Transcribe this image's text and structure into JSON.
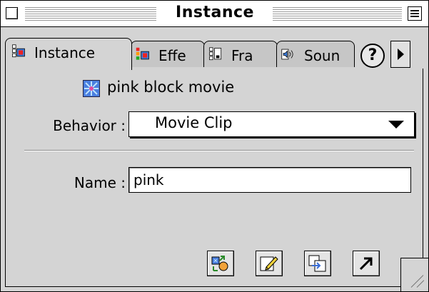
{
  "window": {
    "title": "Instance"
  },
  "tabs": [
    {
      "label": "Instance",
      "icon": "instance-icon",
      "active": true
    },
    {
      "label": "Effe",
      "icon": "effect-icon",
      "active": false
    },
    {
      "label": "Fra",
      "icon": "frame-icon",
      "active": false
    },
    {
      "label": "Soun",
      "icon": "sound-icon",
      "active": false
    }
  ],
  "help_label": "?",
  "symbol": {
    "name": "pink block movie",
    "icon": "movie-clip-symbol-icon"
  },
  "behavior": {
    "label": "Behavior :",
    "value": "Movie Clip"
  },
  "name_field": {
    "label": "Name :",
    "value": "pink"
  },
  "colors": {
    "panel": "#d4d4d4",
    "tab": "#c6c6c6",
    "border": "#000000"
  },
  "buttons": [
    {
      "icon": "swap-symbol-icon"
    },
    {
      "icon": "edit-symbol-icon"
    },
    {
      "icon": "duplicate-symbol-icon"
    },
    {
      "icon": "go-to-symbol-icon"
    }
  ]
}
